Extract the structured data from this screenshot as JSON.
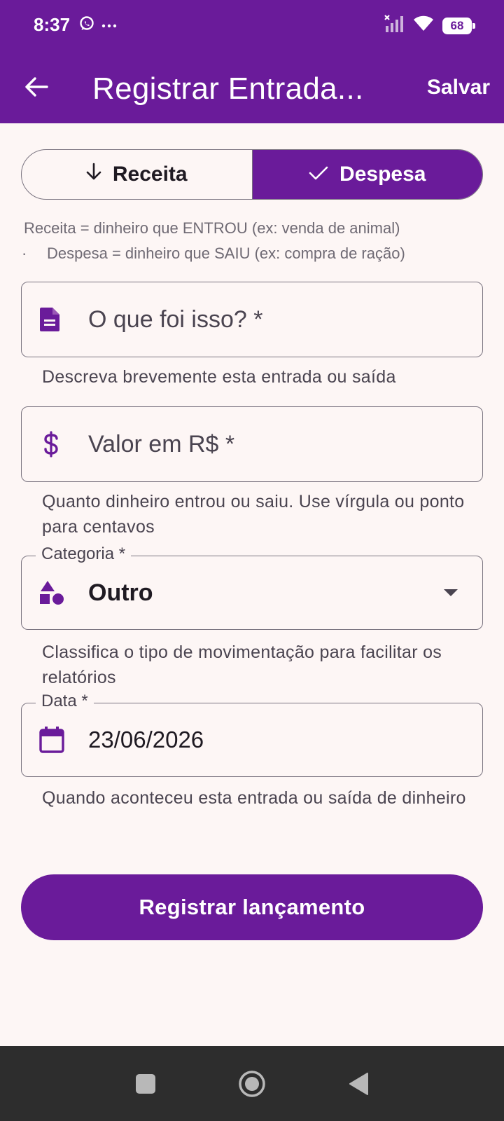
{
  "status_bar": {
    "time": "8:37",
    "icons": [
      "whatsapp-icon",
      "more-dots-icon",
      "signal-off-icon",
      "wifi-icon"
    ],
    "battery": "68"
  },
  "app_bar": {
    "title": "Registrar Entrada...",
    "save_label": "Salvar",
    "back_icon": "arrow-back-icon",
    "color": "#6a1b9a"
  },
  "type_toggle": {
    "options": [
      {
        "label": "Receita",
        "icon": "arrow-down-icon",
        "selected": false
      },
      {
        "label": "Despesa",
        "icon": "check-icon",
        "selected": true
      }
    ]
  },
  "type_hint": {
    "line1": "Receita = dinheiro que ENTROU (ex: venda de animal)",
    "bullet": "·",
    "line2": "Despesa = dinheiro que SAIU (ex: compra de ração)"
  },
  "fields": {
    "description": {
      "placeholder": "O que foi isso? *",
      "icon": "document-icon",
      "helper": "Descreva brevemente esta entrada ou saída"
    },
    "amount": {
      "placeholder": "Valor em R$ *",
      "icon": "dollar-icon",
      "helper": "Quanto dinheiro entrou ou saiu. Use vírgula ou ponto para centavos"
    },
    "category": {
      "label": "Categoria *",
      "value": "Outro",
      "icon": "category-shapes-icon",
      "helper": "Classifica o tipo de movimentação para facilitar os relatórios"
    },
    "date": {
      "label": "Data *",
      "value": "23/06/2026",
      "icon": "calendar-icon",
      "helper": "Quando aconteceu esta entrada ou saída de dinheiro"
    }
  },
  "submit_label": "Registrar lançamento",
  "nav_bar": {
    "items": [
      "recent-apps-icon",
      "home-icon",
      "back-triangle-icon"
    ]
  }
}
